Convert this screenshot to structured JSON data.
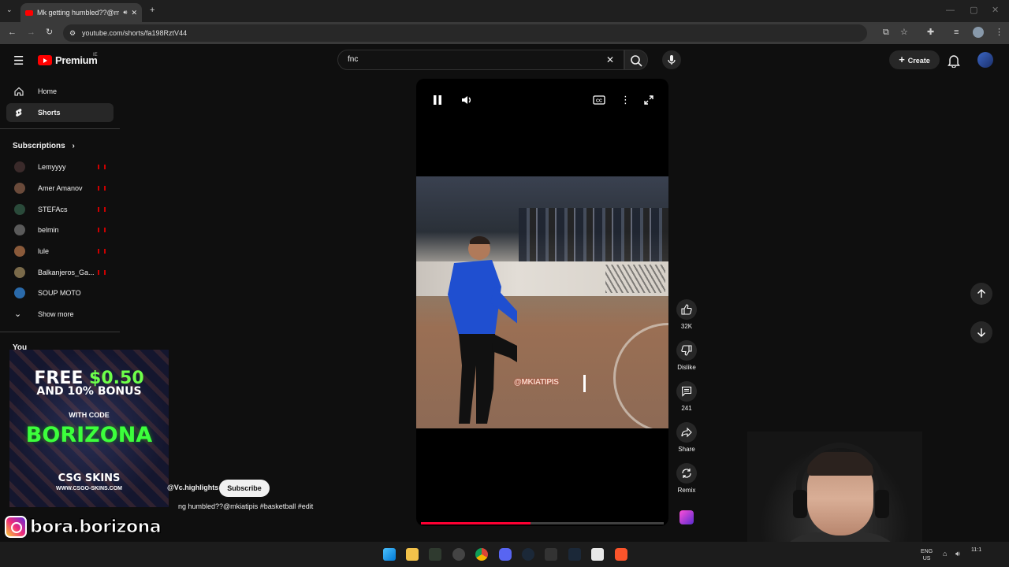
{
  "browser": {
    "tab_title": "Mk getting humbled??@mk",
    "url": "youtube.com/shorts/fa198RztV44"
  },
  "header": {
    "brand": "Premium",
    "region": "IE",
    "search_value": "fnc",
    "create_label": "Create"
  },
  "sidebar": {
    "home": "Home",
    "shorts": "Shorts",
    "subscriptions_title": "Subscriptions",
    "subscriptions": [
      {
        "name": "Lemyyyy",
        "color": "#3a2a2a"
      },
      {
        "name": "Amer Amanov",
        "color": "#6a4a3a"
      },
      {
        "name": "STEFAcs",
        "color": "#2a4a3a"
      },
      {
        "name": "belmin",
        "color": "#5a5a5a"
      },
      {
        "name": "lule",
        "color": "#8a5a3a"
      },
      {
        "name": "Balkanjeros_Ga...",
        "color": "#7a6a4a"
      },
      {
        "name": "SOUP MOTO",
        "color": "#2a6aaa"
      }
    ],
    "show_more": "Show more",
    "you_label": "You"
  },
  "short": {
    "overlay_tag": "@MKIATIPIS",
    "channel": "@Vc.highlights",
    "subscribe_label": "Subscribe",
    "caption": "ng humbled??@mkiatipis #basketball #edit",
    "progress_fraction": 0.45
  },
  "actions": {
    "likes": "32K",
    "dislike": "Dislike",
    "comments": "241",
    "share": "Share",
    "remix": "Remix"
  },
  "ad": {
    "line1_prefix": "FREE ",
    "line1_amount": "$0.50",
    "line2": "AND 10% BONUS",
    "line3": "WITH CODE",
    "code": "BORIZONA",
    "brand": "CSG SKINS",
    "site": "WWW.CSGO-SKINS.COM"
  },
  "streamer": {
    "instagram": "bora.borizona"
  },
  "taskbar": {
    "lang_top": "ENG",
    "lang_bottom": "US",
    "clock": "11:1"
  },
  "colors": {
    "youtube_red": "#ff0000",
    "progress": "#ff0033",
    "code_green": "#3cff3c"
  }
}
